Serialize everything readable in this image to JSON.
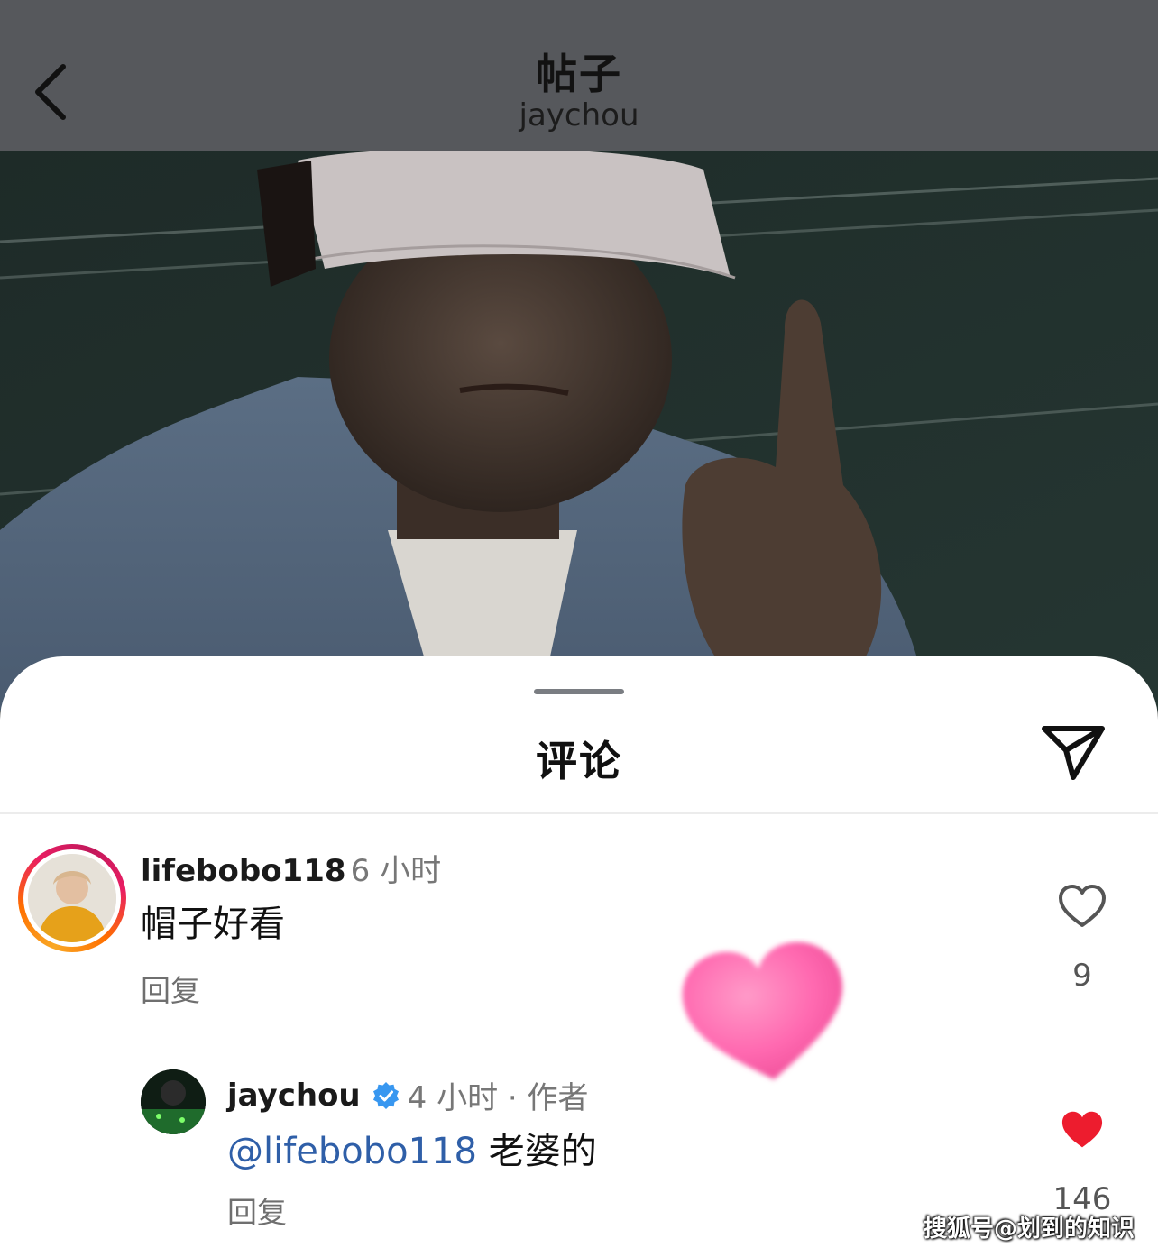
{
  "header": {
    "title": "帖子",
    "subtitle": "jaychou",
    "back_icon": "chevron-left-icon"
  },
  "sheet": {
    "title": "评论",
    "share_icon": "paper-plane-icon"
  },
  "comments": [
    {
      "username": "lifebobo118",
      "time": "6 小时",
      "text": "帽子好看",
      "reply_label": "回复",
      "likes": "9",
      "liked": false
    },
    {
      "username": "jaychou",
      "verified": true,
      "time": "4 小时 · 作者",
      "mention": "@lifebobo118",
      "text": " 老婆的",
      "reply_label": "回复",
      "likes": "146",
      "liked": true
    }
  ],
  "watermark": "搜狐号@划到的知识",
  "colors": {
    "header_bg": "#56585c",
    "mention": "#2f5fa8",
    "liked_heart": "#ed1c2e",
    "verified_badge": "#3897f0"
  }
}
